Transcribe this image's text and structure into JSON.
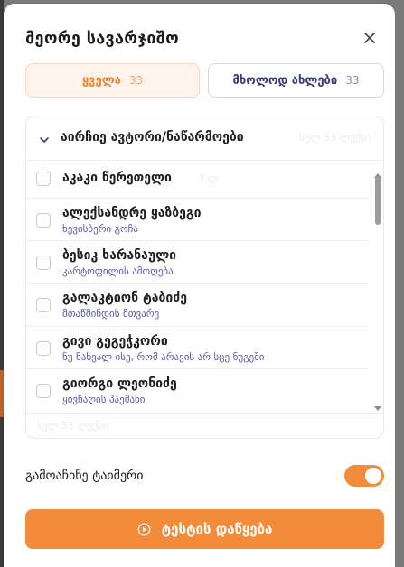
{
  "dialog": {
    "title": "მეორე სავარჯიშო",
    "close_icon": "close-icon"
  },
  "tabs": [
    {
      "label": "ყველა",
      "count": "33",
      "active": true
    },
    {
      "label": "მხოლოდ ახლები",
      "count": "33",
      "active": false
    }
  ],
  "selector": {
    "header": "აირჩიე ავტორი/ნაწარმოები",
    "header_ghost": "სულ 33 ლექსი",
    "footer_ghost": "სულ 33 ლექსი",
    "items": [
      {
        "name": "აკაკი წერეთელი",
        "subtitle": "",
        "ghost": "3 ლ"
      },
      {
        "name": "ალექსანდრე ყაზბეგი",
        "subtitle": "ხევისბერი გოჩა"
      },
      {
        "name": "ბესიკ ხარანაული",
        "subtitle": "კარტოფილის ამოღება"
      },
      {
        "name": "გალაკტიონ ტაბიძე",
        "subtitle": "მთაწმინდის მთვარე"
      },
      {
        "name": "გივი გეგეჭკორი",
        "subtitle": "ნუ ნახვალ ისე, რომ არავის არ სცე ნუგეში"
      },
      {
        "name": "გიორგი ლეონიძე",
        "subtitle": "ყივჩაღის პაემანი"
      }
    ]
  },
  "timer": {
    "label": "გამოაჩინე ტაიმერი",
    "enabled": true
  },
  "start_button": {
    "label": "ტესტის დაწყება"
  },
  "colors": {
    "accent": "#f28c3a",
    "subtitle": "#5b58a8"
  }
}
